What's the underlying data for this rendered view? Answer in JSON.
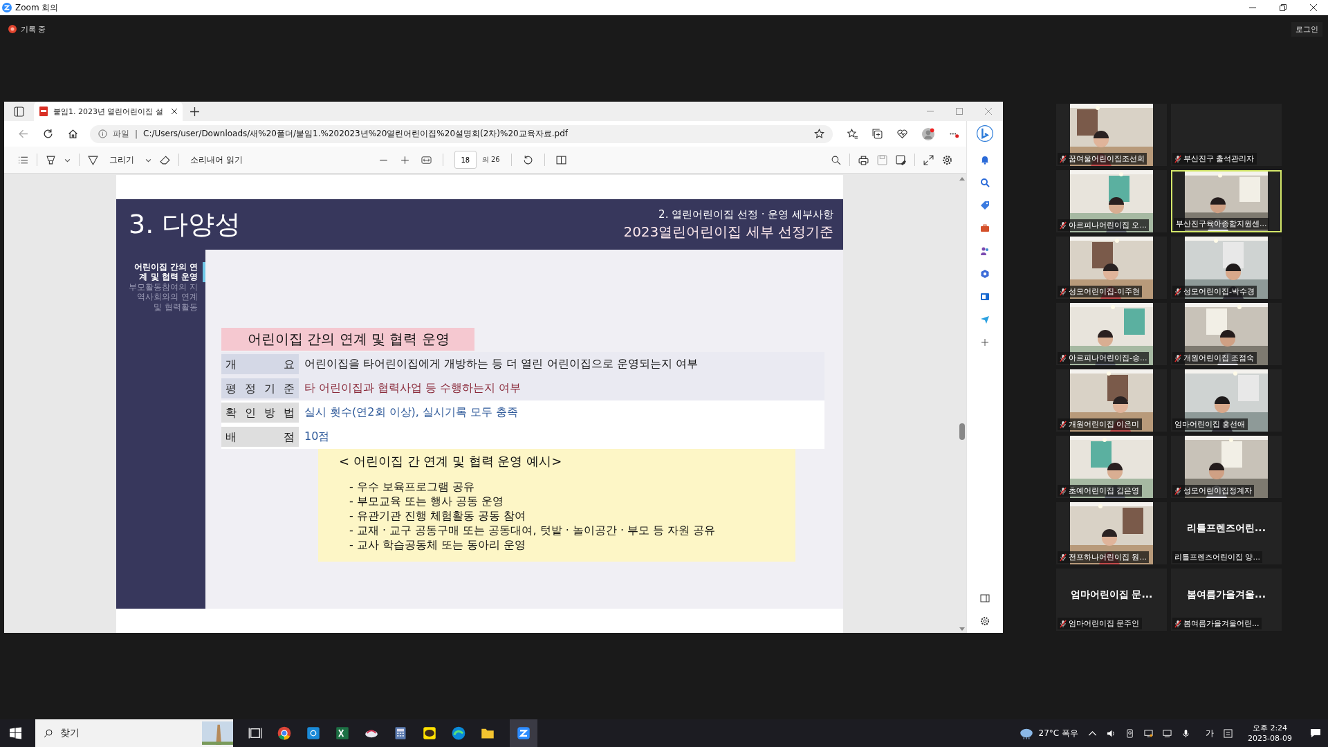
{
  "window": {
    "title": "Zoom 회의"
  },
  "meeting": {
    "recording_label": "기록 중",
    "login": "로그인"
  },
  "browser": {
    "tab_title": "붙임1. 2023년 열린어린이집 설",
    "address_scheme": "파일",
    "address_separator": "|",
    "address": "C:/Users/user/Downloads/새%20폴더/붙임1.%202023년%20열린어린이집%20설명회(2차)%20교육자료.pdf",
    "draw_label": "그리기",
    "read_aloud": "소리내어 읽기",
    "page_number": "18",
    "page_total": "의 26"
  },
  "slide": {
    "heading": "3. 다양성",
    "subtitle": "2. 열린어린이집 선정 · 운영 세부사항",
    "title": "2023열린어린이집 세부 선정기준",
    "nav": [
      {
        "label": "어린이집 간의 연계 및 협력 운영",
        "selected": true
      },
      {
        "label": "부모활동참여의 지역사회와의 연계 및 협력활동",
        "selected": false
      }
    ],
    "section_title": "어린이집 간의 연계 및 협력 운영",
    "rows": [
      {
        "label": "개 요",
        "value": "어린이집을 타어린이집에게 개방하는 등 더 열린 어린이집으로 운영되는지 여부",
        "color": "#111111"
      },
      {
        "label": "평 정 기 준",
        "value": "타 어린이집과 협력사업 등 수행하는지 여부",
        "color": "#8a2a3a"
      },
      {
        "label": "확 인 방 법",
        "value": "실시 횟수(연2회 이상), 실시기록 모두 충족",
        "color": "#2f5a9a"
      },
      {
        "label": "배 점",
        "value": "10점",
        "color": "#2f5a9a"
      }
    ],
    "example": {
      "title": "< 어린이집 간 연계 및 협력 운영 예시>",
      "items": [
        "- 우수 보육프로그램 공유",
        "- 부모교육 또는 행사 공동 운영",
        "- 유관기관 진행 체험활동 공동 참여",
        "- 교재 · 교구 공동구매 또는 공동대여, 텃밭 · 놀이공간 · 부모 등 자원 공유",
        "- 교사 학습공동체 또는 동아리 운영"
      ]
    }
  },
  "participants": [
    {
      "name": "꿈여울어린이집조선희",
      "muted": true,
      "video": true,
      "selected": false
    },
    {
      "name": "부산진구 출석관리자",
      "muted": true,
      "video": false,
      "selected": false
    },
    {
      "name": "아르피나어린이집 오...",
      "muted": true,
      "video": true,
      "selected": false
    },
    {
      "name": "부산진구육아종합지원센...",
      "muted": false,
      "video": true,
      "selected": true
    },
    {
      "name": "성모어린이집-이주현",
      "muted": true,
      "video": true,
      "selected": false
    },
    {
      "name": "성모어린이집-박수경",
      "muted": true,
      "video": true,
      "selected": false
    },
    {
      "name": "아르피나어린이집-송...",
      "muted": true,
      "video": true,
      "selected": false
    },
    {
      "name": "개원어린이집 조점숙",
      "muted": true,
      "video": true,
      "selected": false
    },
    {
      "name": "개원어린이집 이은미",
      "muted": true,
      "video": true,
      "selected": false
    },
    {
      "name": "엄마어린이집 홍선애",
      "muted": false,
      "video": true,
      "selected": false
    },
    {
      "name": "초예어린이집 김은영",
      "muted": true,
      "video": true,
      "selected": false
    },
    {
      "name": "성모어린이집정계자",
      "muted": true,
      "video": true,
      "selected": false
    },
    {
      "name": "전포하나어린이집 원...",
      "muted": true,
      "video": true,
      "selected": false
    },
    {
      "name": "리틀프렌즈어린이집 양...",
      "banner": "리틀프렌즈어린...",
      "muted": false,
      "video": false,
      "selected": false
    },
    {
      "name": "엄마어린이집 문주인",
      "banner": "엄마어린이집 문...",
      "muted": true,
      "video": false,
      "selected": false
    },
    {
      "name": "봄여름가을겨울어린...",
      "banner": "봄여름가을겨울...",
      "muted": true,
      "video": false,
      "selected": false
    }
  ],
  "taskbar": {
    "search": "찾기",
    "weather": "27°C 폭우",
    "ime": "가",
    "time": "오후 2:24",
    "date": "2023-08-09"
  }
}
